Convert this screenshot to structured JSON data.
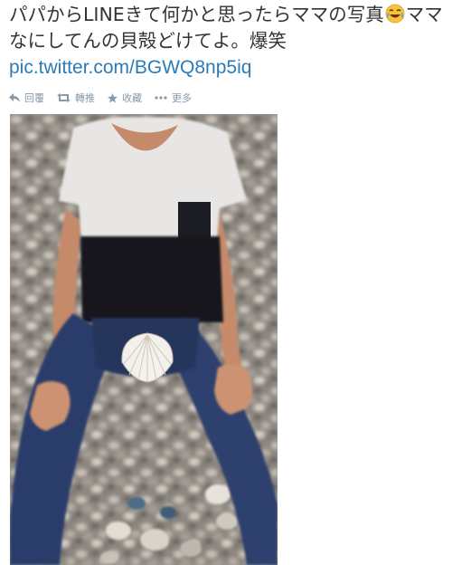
{
  "tweet": {
    "text_before_emoji": "パパからLINEきて何かと思ったらママの写真",
    "emoji": "face-with-tears-of-joy",
    "text_after_emoji": "ママなにしてんの貝殻どけてよ。爆笑",
    "link": "pic.twitter.com/BGWQ8np5iq"
  },
  "actions": [
    {
      "icon": "reply-icon",
      "label": "回覆"
    },
    {
      "icon": "retweet-icon",
      "label": "轉推"
    },
    {
      "icon": "star-icon",
      "label": "收藏"
    },
    {
      "icon": "more-icon",
      "label": "更多"
    }
  ],
  "colors": {
    "text": "#333333",
    "link": "#2b7bb9",
    "action": "#8899a6"
  }
}
